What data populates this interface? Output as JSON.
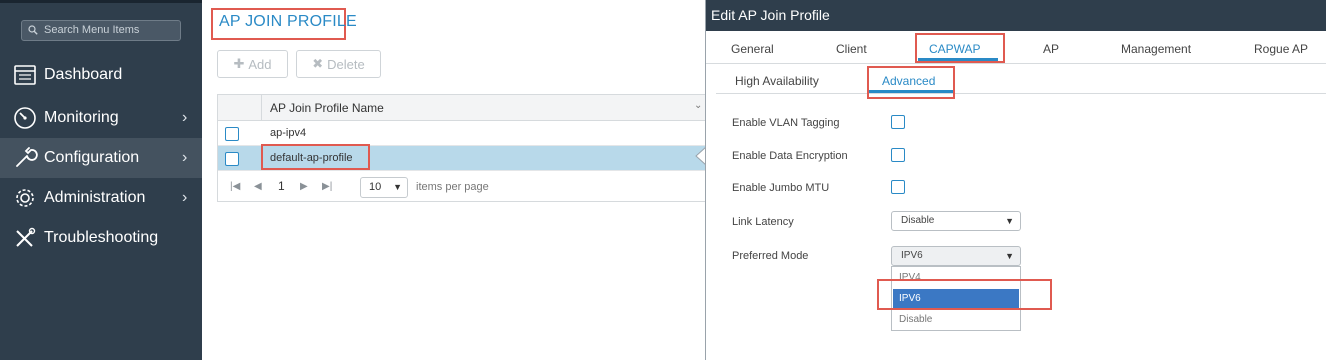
{
  "sidebar": {
    "search_placeholder": "Search Menu Items",
    "items": [
      {
        "label": "Dashboard",
        "icon": "dashboard-icon",
        "has_chevron": false
      },
      {
        "label": "Monitoring",
        "icon": "monitoring-gauge-icon",
        "has_chevron": true
      },
      {
        "label": "Configuration",
        "icon": "wrench-icon",
        "has_chevron": true,
        "active": true
      },
      {
        "label": "Administration",
        "icon": "gear-icon",
        "has_chevron": true
      },
      {
        "label": "Troubleshooting",
        "icon": "tools-icon",
        "has_chevron": false
      }
    ]
  },
  "profiles": {
    "title": "AP JOIN PROFILE",
    "add_label": "Add",
    "delete_label": "Delete",
    "column_header": "AP Join Profile Name",
    "rows": [
      {
        "name": "ap-ipv4",
        "selected": false
      },
      {
        "name": "default-ap-profile",
        "selected": true
      }
    ],
    "pager": {
      "page": "1",
      "per_page": "10",
      "per_page_label": "items per page"
    }
  },
  "edit": {
    "title": "Edit AP Join Profile",
    "tabs": [
      "General",
      "Client",
      "CAPWAP",
      "AP",
      "Management",
      "Rogue AP"
    ],
    "active_tab": "CAPWAP",
    "subtabs": [
      "High Availability",
      "Advanced"
    ],
    "active_subtab": "Advanced",
    "fields": {
      "vlan_tagging": {
        "label": "Enable VLAN Tagging",
        "checked": false
      },
      "data_encryption": {
        "label": "Enable Data Encryption",
        "checked": false
      },
      "jumbo_mtu": {
        "label": "Enable Jumbo MTU",
        "checked": false
      },
      "link_latency": {
        "label": "Link Latency",
        "value": "Disable"
      },
      "preferred_mode": {
        "label": "Preferred Mode",
        "value": "IPV6",
        "options": [
          "IPV4",
          "IPV6",
          "Disable"
        ],
        "highlighted": "IPV6"
      }
    }
  },
  "colors": {
    "sidebar_bg": "#2f3e4c",
    "accent": "#2a8ac6",
    "highlight_box": "#e05a50",
    "selected_row": "#b8d9ea",
    "selected_option": "#3b78c4"
  }
}
